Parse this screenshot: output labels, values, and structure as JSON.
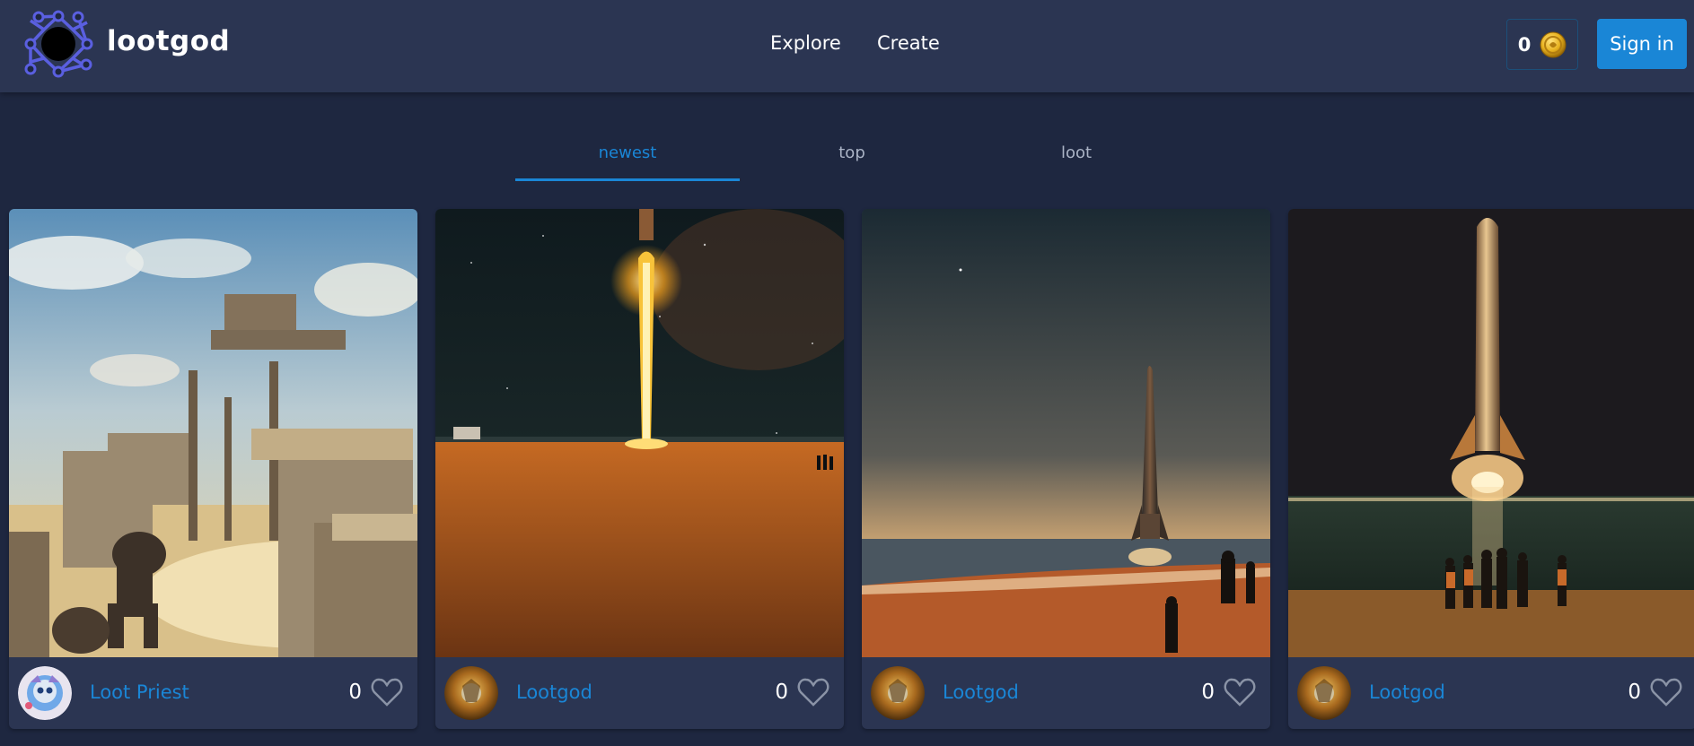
{
  "header": {
    "brand": "lootgod",
    "nav": {
      "explore": "Explore",
      "create": "Create"
    },
    "balance": "0",
    "signin_label": "Sign in"
  },
  "tabs": [
    {
      "label": "newest",
      "active": true
    },
    {
      "label": "top",
      "active": false
    },
    {
      "label": "loot",
      "active": false
    }
  ],
  "colors": {
    "accent": "#1a86d6",
    "background": "#1e2740",
    "panel": "#2b3552",
    "logo": "#5a5fe0",
    "coin": "#e8b21f"
  },
  "cards": [
    {
      "author": "Loot Priest",
      "likes": "0",
      "image": "ruined-desert-tower-painting",
      "avatar": "loot-priest-avatar"
    },
    {
      "author": "Lootgod",
      "likes": "0",
      "image": "rocket-launch-beach-night",
      "avatar": "lootgod-avatar"
    },
    {
      "author": "Lootgod",
      "likes": "0",
      "image": "rocket-on-beach-sunset",
      "avatar": "lootgod-avatar"
    },
    {
      "author": "Lootgod",
      "likes": "0",
      "image": "rocket-launch-over-sea",
      "avatar": "lootgod-avatar"
    }
  ]
}
